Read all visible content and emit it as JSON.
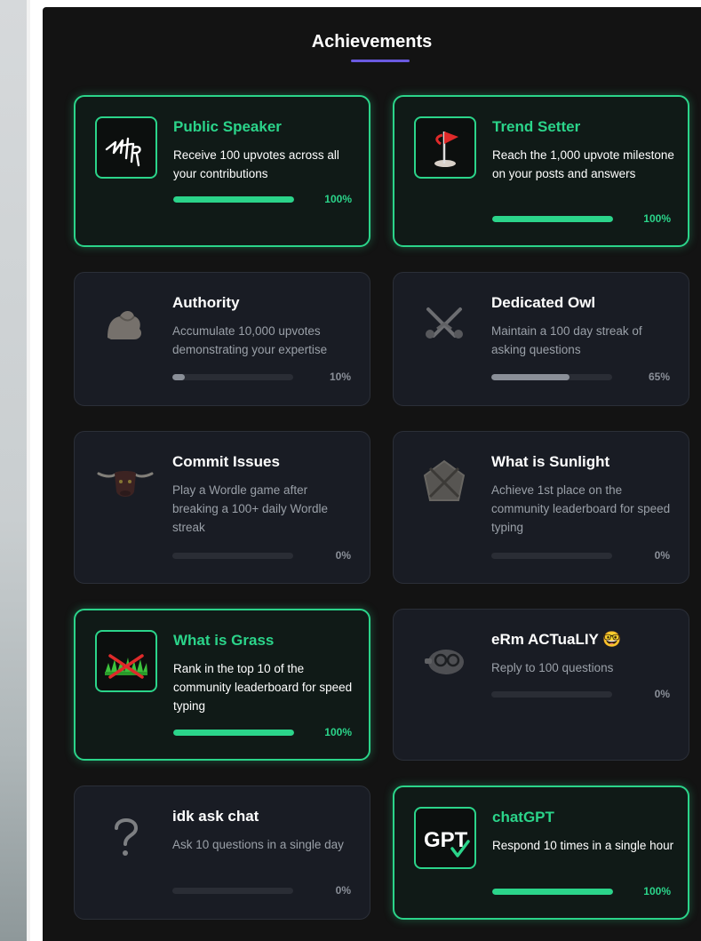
{
  "panel": {
    "title": "Achievements"
  },
  "achievements": [
    {
      "title": "Public Speaker",
      "description": "Receive 100 upvotes across all your contributions",
      "progress_percent": 100,
      "progress_label": "100%",
      "earned": true,
      "icon": "scribble-icon"
    },
    {
      "title": "Trend Setter",
      "description": "Reach the 1,000 upvote milestone on your posts and answers",
      "progress_percent": 100,
      "progress_label": "100%",
      "earned": true,
      "icon": "golf-flag-icon"
    },
    {
      "title": "Authority",
      "description": "Accumulate 10,000 upvotes demonstrating your expertise",
      "progress_percent": 10,
      "progress_label": "10%",
      "earned": false,
      "icon": "flexed-arm-icon"
    },
    {
      "title": "Dedicated Owl",
      "description": "Maintain a 100 day streak of asking questions",
      "progress_percent": 65,
      "progress_label": "65%",
      "earned": false,
      "icon": "crossed-swords-icon"
    },
    {
      "title": "Commit Issues",
      "description": "Play a Wordle game after breaking a 100+ daily Wordle streak",
      "progress_percent": 0,
      "progress_label": "0%",
      "earned": false,
      "icon": "bull-head-icon"
    },
    {
      "title": "What is Sunlight",
      "description": "Achieve 1st place on the community leaderboard for speed typing",
      "progress_percent": 0,
      "progress_label": "0%",
      "earned": false,
      "icon": "crossed-shield-icon"
    },
    {
      "title": "What is Grass",
      "description": "Rank in the top 10 of the community leaderboard for speed typing",
      "progress_percent": 100,
      "progress_label": "100%",
      "earned": true,
      "icon": "crossed-out-grass-icon"
    },
    {
      "title": "eRm ACTuaLIY",
      "title_emoji": "🤓",
      "description": "Reply to 100 questions",
      "progress_percent": 0,
      "progress_label": "0%",
      "earned": false,
      "icon": "nerd-glasses-icon"
    },
    {
      "title": "idk ask chat",
      "description": "Ask 10 questions in a single day",
      "progress_percent": 0,
      "progress_label": "0%",
      "earned": false,
      "icon": "question-mark-icon"
    },
    {
      "title": "chatGPT",
      "description": "Respond 10 times in a single hour",
      "progress_percent": 100,
      "progress_label": "100%",
      "earned": true,
      "icon": "gpt-check-icon"
    }
  ],
  "colors": {
    "accent": "#2bd48a",
    "underline": "#6a5ae0",
    "panel_bg": "#131313",
    "card_bg": "#191c24"
  }
}
